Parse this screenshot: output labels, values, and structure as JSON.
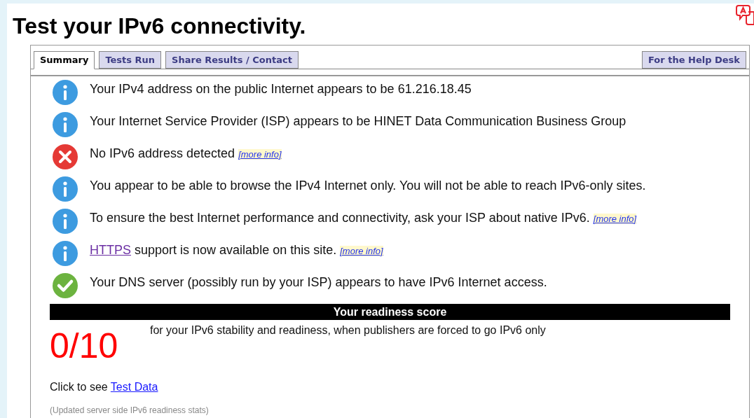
{
  "title": "Test your IPv6 connectivity.",
  "tabs": [
    {
      "label": "Summary",
      "selected": true
    },
    {
      "label": "Tests Run",
      "selected": false
    },
    {
      "label": "Share Results / Contact",
      "selected": false
    }
  ],
  "help_tab": {
    "label": "For the Help Desk",
    "selected": false
  },
  "messages": [
    {
      "kind": "info",
      "text": "Your IPv4 address on the public Internet appears to be 61.216.18.45"
    },
    {
      "kind": "info",
      "text": "Your Internet Service Provider (ISP) appears to be HINET Data Communication Business Group"
    },
    {
      "kind": "error",
      "text": "No IPv6 address detected",
      "more_info": "[more info]"
    },
    {
      "kind": "info",
      "text": "You appear to be able to browse the IPv4 Internet only. You will not be able to reach IPv6-only sites."
    },
    {
      "kind": "info",
      "text": "To ensure the best Internet performance and connectivity, ask your ISP about native IPv6.",
      "more_info": "[more info]"
    },
    {
      "kind": "info",
      "lead_link": "HTTPS",
      "text": "support is now available on this site.",
      "more_info": "[more info]"
    },
    {
      "kind": "ok",
      "text": "Your DNS server (possibly run by your ISP) appears to have IPv6 Internet access."
    }
  ],
  "score": {
    "heading": "Your readiness score",
    "value": "0/10",
    "description": "for your IPv6 stability and readiness, when publishers are forced to go IPv6 only"
  },
  "test_data": {
    "prefix": "Click to see",
    "link": "Test Data"
  },
  "footnote": "(Updated server side IPv6 readiness stats)"
}
